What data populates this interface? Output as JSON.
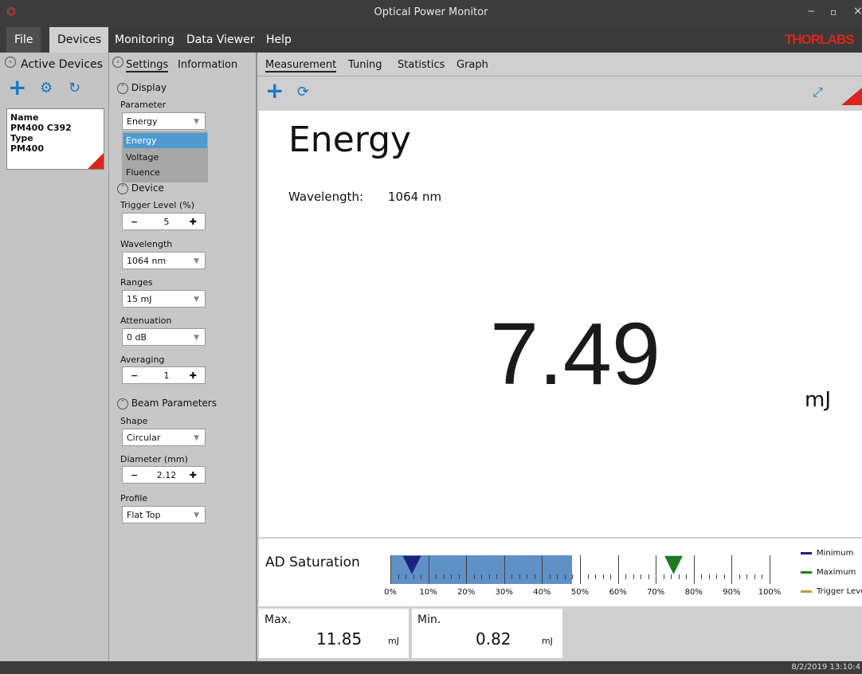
{
  "window": {
    "title": "Optical Power Monitor",
    "brand": "THORLABS",
    "brand_color": "#d9261c",
    "controls": {
      "minimize": "‒",
      "maximize": "▫",
      "close": "×"
    }
  },
  "menu": {
    "items": [
      "File",
      "Devices",
      "Monitoring",
      "Data Viewer",
      "Help"
    ],
    "active": "Devices"
  },
  "devices_panel": {
    "title": "Active Devices",
    "icons": [
      "add-icon",
      "connect-icon",
      "link-icon"
    ],
    "device": {
      "name_label": "Name",
      "name": "PM400 C392",
      "type_label": "Type",
      "type": "PM400"
    }
  },
  "settings_panel": {
    "tabs": [
      "Settings",
      "Information"
    ],
    "display_label": "Display",
    "parameter_label": "Parameter",
    "parameter_value": "Energy",
    "parameter_options": [
      "Energy",
      "Voltage",
      "Fluence"
    ],
    "device_label": "Device",
    "trigger_label": "Trigger Level (%)",
    "trigger_value": "5",
    "wavelength_label": "Wavelength",
    "wavelength_value": "1064 nm",
    "ranges_label": "Ranges",
    "ranges_value": "15 mJ",
    "attenuation_label": "Attenuation",
    "attenuation_value": "0 dB",
    "averaging_label": "Averaging",
    "averaging_value": "1",
    "beam_label": "Beam Parameters",
    "shape_label": "Shape",
    "shape_value": "Circular",
    "diameter_label": "Diameter (mm)",
    "diameter_value": "2.12",
    "profile_label": "Profile",
    "profile_value": "Flat Top"
  },
  "measurement": {
    "tabs": [
      "Measurement",
      "Tuning",
      "Statistics",
      "Graph"
    ],
    "quantity": "Energy",
    "wavelength_label": "Wavelength:",
    "wavelength_value": "1064 nm",
    "value": "7.49",
    "unit": "mJ"
  },
  "saturation": {
    "label": "AD Saturation",
    "fill_fraction": 0.48,
    "min_marker_fraction": 0.06,
    "max_marker_fraction": 0.75,
    "scale_labels": [
      "0%",
      "10%",
      "20%",
      "30%",
      "40%",
      "50%",
      "60%",
      "70%",
      "80%",
      "90%",
      "100%"
    ],
    "legend": [
      {
        "label": "Minimum",
        "color": "#1a237e"
      },
      {
        "label": "Maximum",
        "color": "#1f7a1f"
      },
      {
        "label": "Trigger Level",
        "color": "#c49a2a"
      }
    ]
  },
  "stats": {
    "max_label": "Max.",
    "max_value": "11.85",
    "max_unit": "mJ",
    "min_label": "Min.",
    "min_value": "0.82",
    "min_unit": "mJ"
  },
  "status": {
    "datetime": "8/2/2019 13:10:4"
  }
}
